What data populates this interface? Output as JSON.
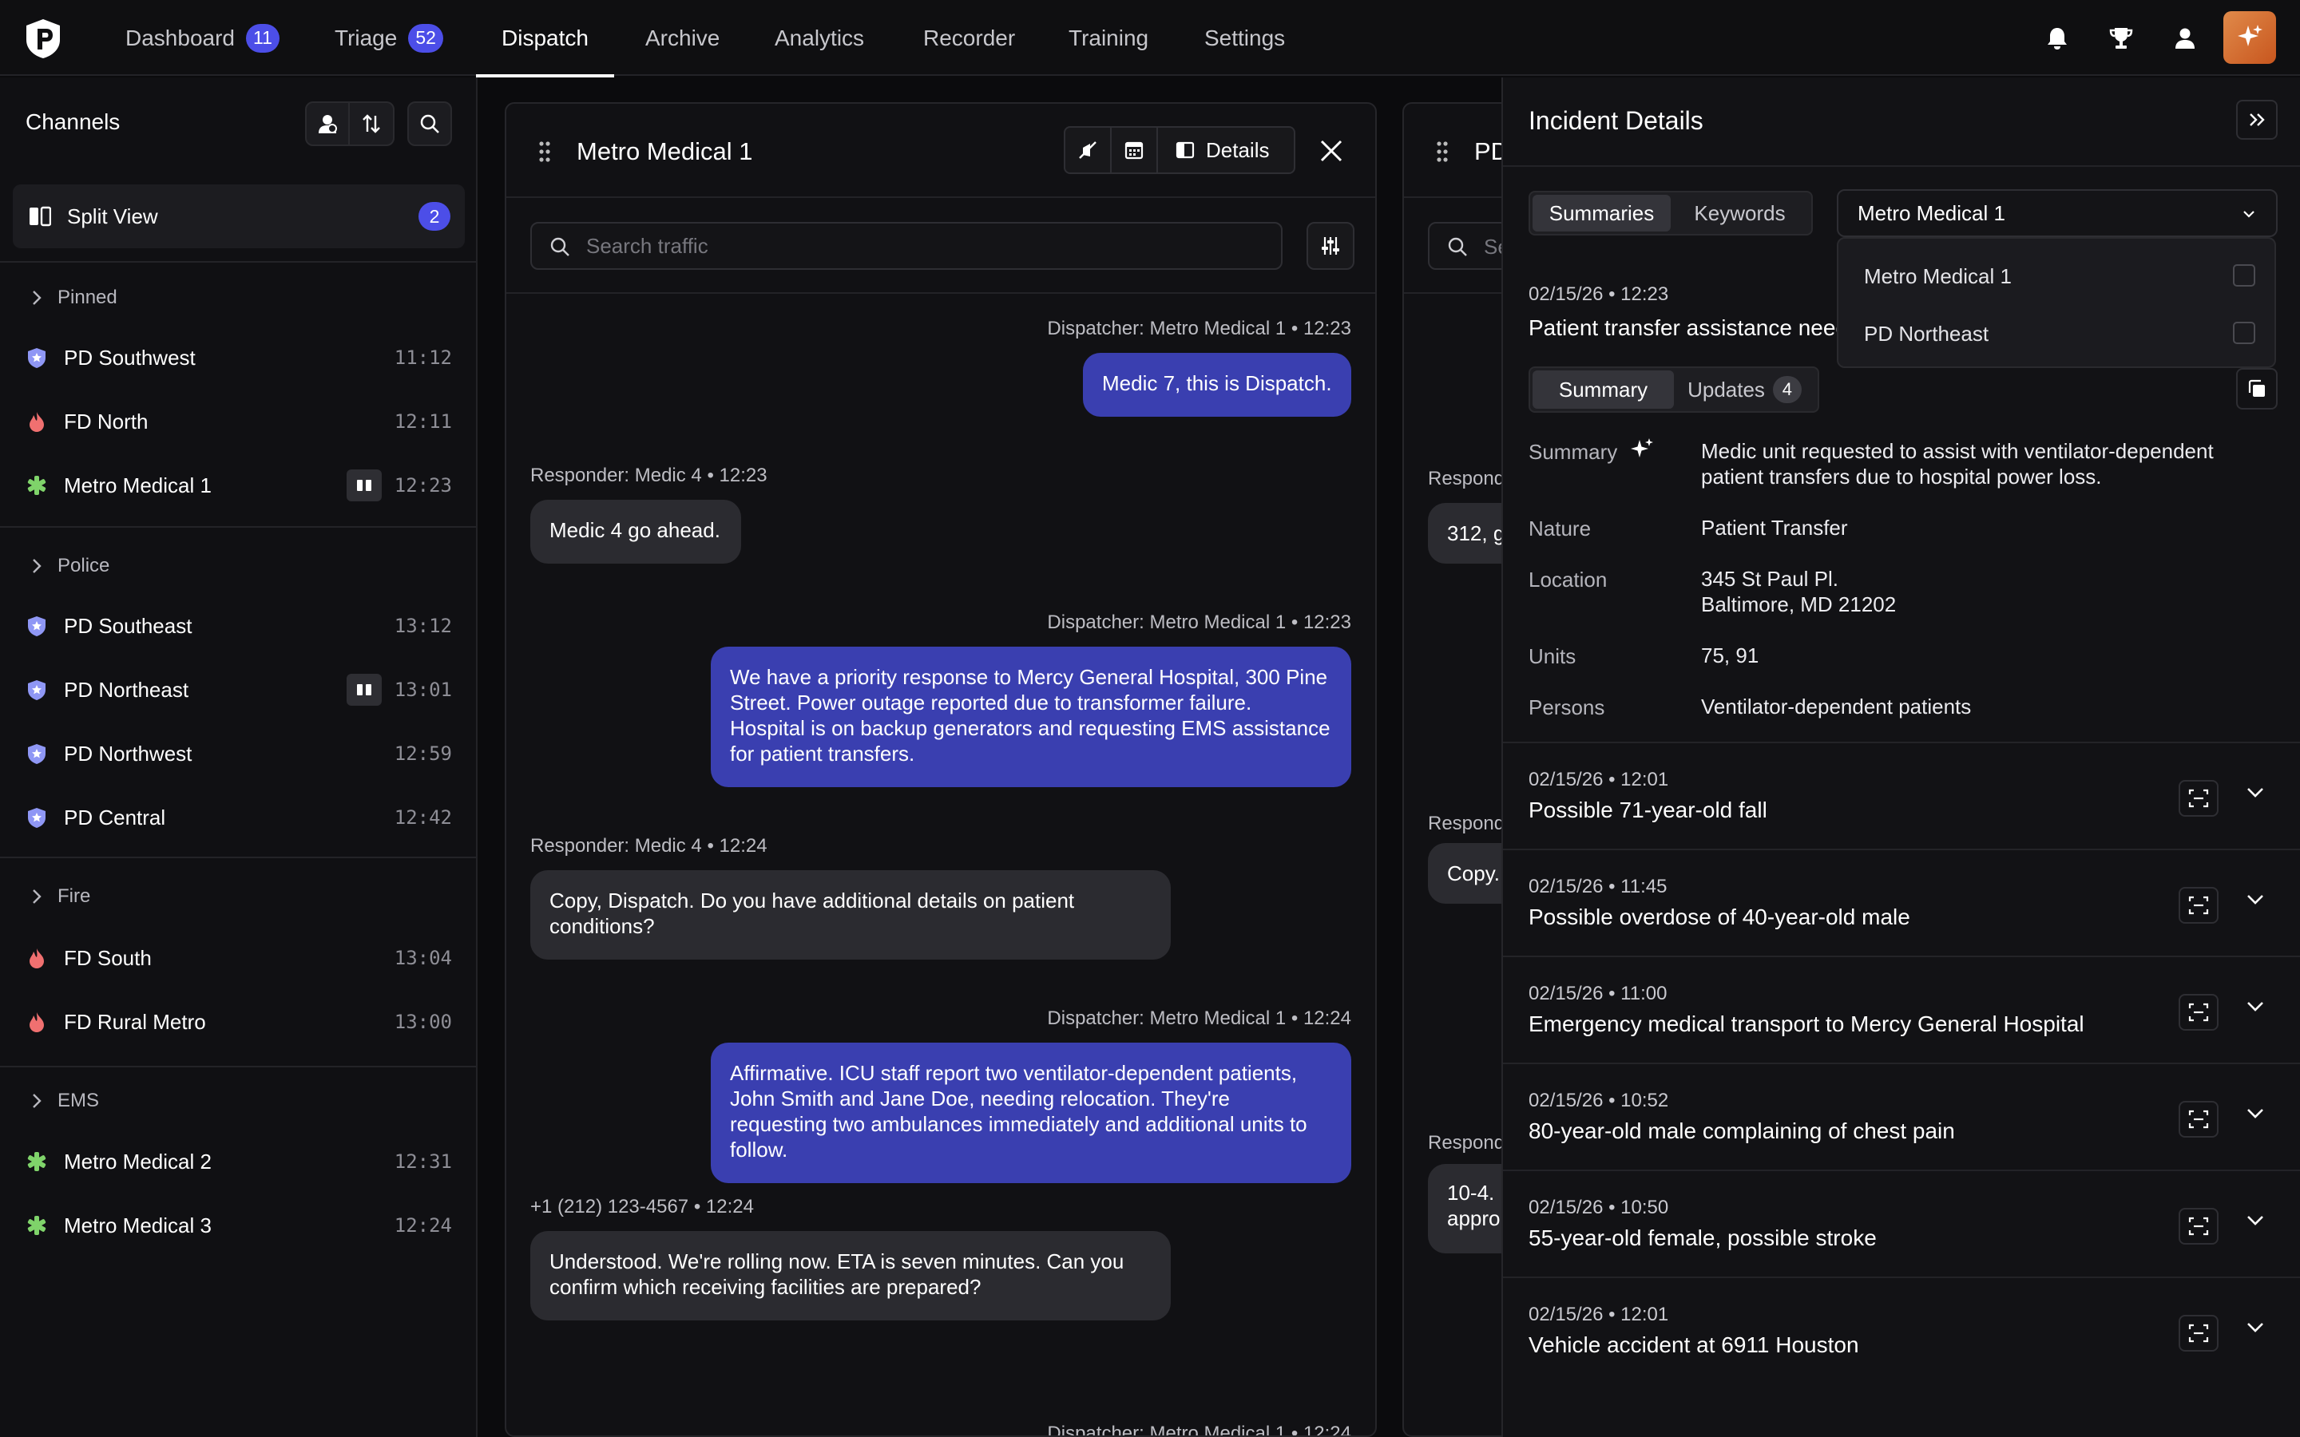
{
  "nav": {
    "items": [
      {
        "label": "Dashboard",
        "badge": "11"
      },
      {
        "label": "Triage",
        "badge": "52"
      },
      {
        "label": "Dispatch",
        "badge": null
      },
      {
        "label": "Archive",
        "badge": null
      },
      {
        "label": "Analytics",
        "badge": null
      },
      {
        "label": "Recorder",
        "badge": null
      },
      {
        "label": "Training",
        "badge": null
      },
      {
        "label": "Settings",
        "badge": null
      }
    ],
    "active": "Dispatch"
  },
  "sidebar": {
    "title": "Channels",
    "split_view": {
      "label": "Split View",
      "count": "2"
    },
    "groups": {
      "pinned": "Pinned",
      "police": "Police",
      "fire": "Fire",
      "ems": "EMS"
    },
    "channels": {
      "pinned": [
        {
          "name": "PD Southwest",
          "time": "11:12",
          "type": "police",
          "split": false
        },
        {
          "name": "FD North",
          "time": "12:11",
          "type": "fire",
          "split": false
        },
        {
          "name": "Metro Medical 1",
          "time": "12:23",
          "type": "ems",
          "split": true
        }
      ],
      "police": [
        {
          "name": "PD Southeast",
          "time": "13:12",
          "type": "police",
          "split": false
        },
        {
          "name": "PD Northeast",
          "time": "13:01",
          "type": "police",
          "split": true
        },
        {
          "name": "PD Northwest",
          "time": "12:59",
          "type": "police",
          "split": false
        },
        {
          "name": "PD Central",
          "time": "12:42",
          "type": "police",
          "split": false
        }
      ],
      "fire": [
        {
          "name": "FD South",
          "time": "13:04",
          "type": "fire",
          "split": false
        },
        {
          "name": "FD Rural Metro",
          "time": "13:00",
          "type": "fire",
          "split": false
        }
      ],
      "ems": [
        {
          "name": "Metro Medical 2",
          "time": "12:31",
          "type": "ems",
          "split": false
        },
        {
          "name": "Metro Medical 3",
          "time": "12:24",
          "type": "ems",
          "split": false
        }
      ]
    }
  },
  "panel": {
    "title": "Metro Medical 1",
    "details_label": "Details",
    "search_placeholder": "Search traffic",
    "messages": [
      {
        "meta": "Dispatcher: Metro Medical 1 • 12:23",
        "text": "Medic 7, this is Dispatch.",
        "dir": "out"
      },
      {
        "meta": "Responder: Medic 4 • 12:23",
        "text": "Medic 4 go ahead.",
        "dir": "in"
      },
      {
        "meta": "Dispatcher: Metro Medical 1 • 12:23",
        "text": "We have a priority response to Mercy General Hospital, 300 Pine Street. Power outage reported due to transformer failure. Hospital is on backup generators and requesting EMS assistance for patient transfers.",
        "dir": "out"
      },
      {
        "meta": "Responder: Medic 4 • 12:24",
        "text": "Copy, Dispatch. Do you have additional details on patient conditions?",
        "dir": "in"
      },
      {
        "meta": "Dispatcher: Metro Medical 1 • 12:24",
        "text": "Affirmative. ICU staff report two ventilator-dependent patients, John Smith and Jane Doe, needing relocation. They're requesting two ambulances immediately and additional units to follow.",
        "dir": "out"
      },
      {
        "meta": "+1 (212) 123-4567 • 12:24",
        "text": "Understood. We're rolling now. ETA is seven minutes. Can you confirm which receiving facilities are prepared?",
        "dir": "in"
      }
    ],
    "partial_meta": "Dispatcher: Metro Medical 1 • 12:24"
  },
  "panel2": {
    "title": "PD",
    "search": "Se",
    "meta": [
      "Respond",
      "Respond",
      "Respond"
    ],
    "bubbles": [
      "312, g",
      "Copy.",
      "10-4. I",
      "appro"
    ]
  },
  "details": {
    "title": "Incident Details",
    "tabs": [
      "Summaries",
      "Keywords"
    ],
    "select_value": "Metro Medical 1",
    "dropdown_options": [
      "Metro Medical 1",
      "PD Northeast"
    ],
    "current": {
      "date": "02/15/26 • 12:23",
      "title": "Patient transfer assistance needed",
      "subtabs": {
        "summary": "Summary",
        "updates": "Updates",
        "updates_count": "4"
      },
      "fields": {
        "summary_label": "Summary",
        "summary": "Medic unit requested to assist with ventilator-dependent patient transfers due to hospital power loss.",
        "nature_label": "Nature",
        "nature": "Patient Transfer",
        "location_label": "Location",
        "location_line1": "345 St Paul Pl.",
        "location_line2": "Baltimore, MD 21202",
        "units_label": "Units",
        "units": "75, 91",
        "persons_label": "Persons",
        "persons": "Ventilator-dependent patients"
      }
    },
    "incidents": [
      {
        "date": "02/15/26 • 12:01",
        "title": "Possible 71-year-old fall"
      },
      {
        "date": "02/15/26 • 11:45",
        "title": "Possible overdose of 40-year-old male"
      },
      {
        "date": "02/15/26 • 11:00",
        "title": "Emergency medical transport to Mercy General Hospital"
      },
      {
        "date": "02/15/26 • 10:52",
        "title": "80-year-old male complaining of chest pain"
      },
      {
        "date": "02/15/26 • 10:50",
        "title": "55-year-old female, possible stroke"
      },
      {
        "date": "02/15/26 • 12:01",
        "title": "Vehicle accident at 6911 Houston"
      }
    ]
  },
  "colors": {
    "accent": "#4c4ee8",
    "outgoing": "#3a3fb0",
    "incoming": "#2b2b30",
    "police": "#8f97f5",
    "fire": "#f07070",
    "ems": "#7fd36a",
    "avatar": "#d8713a"
  }
}
